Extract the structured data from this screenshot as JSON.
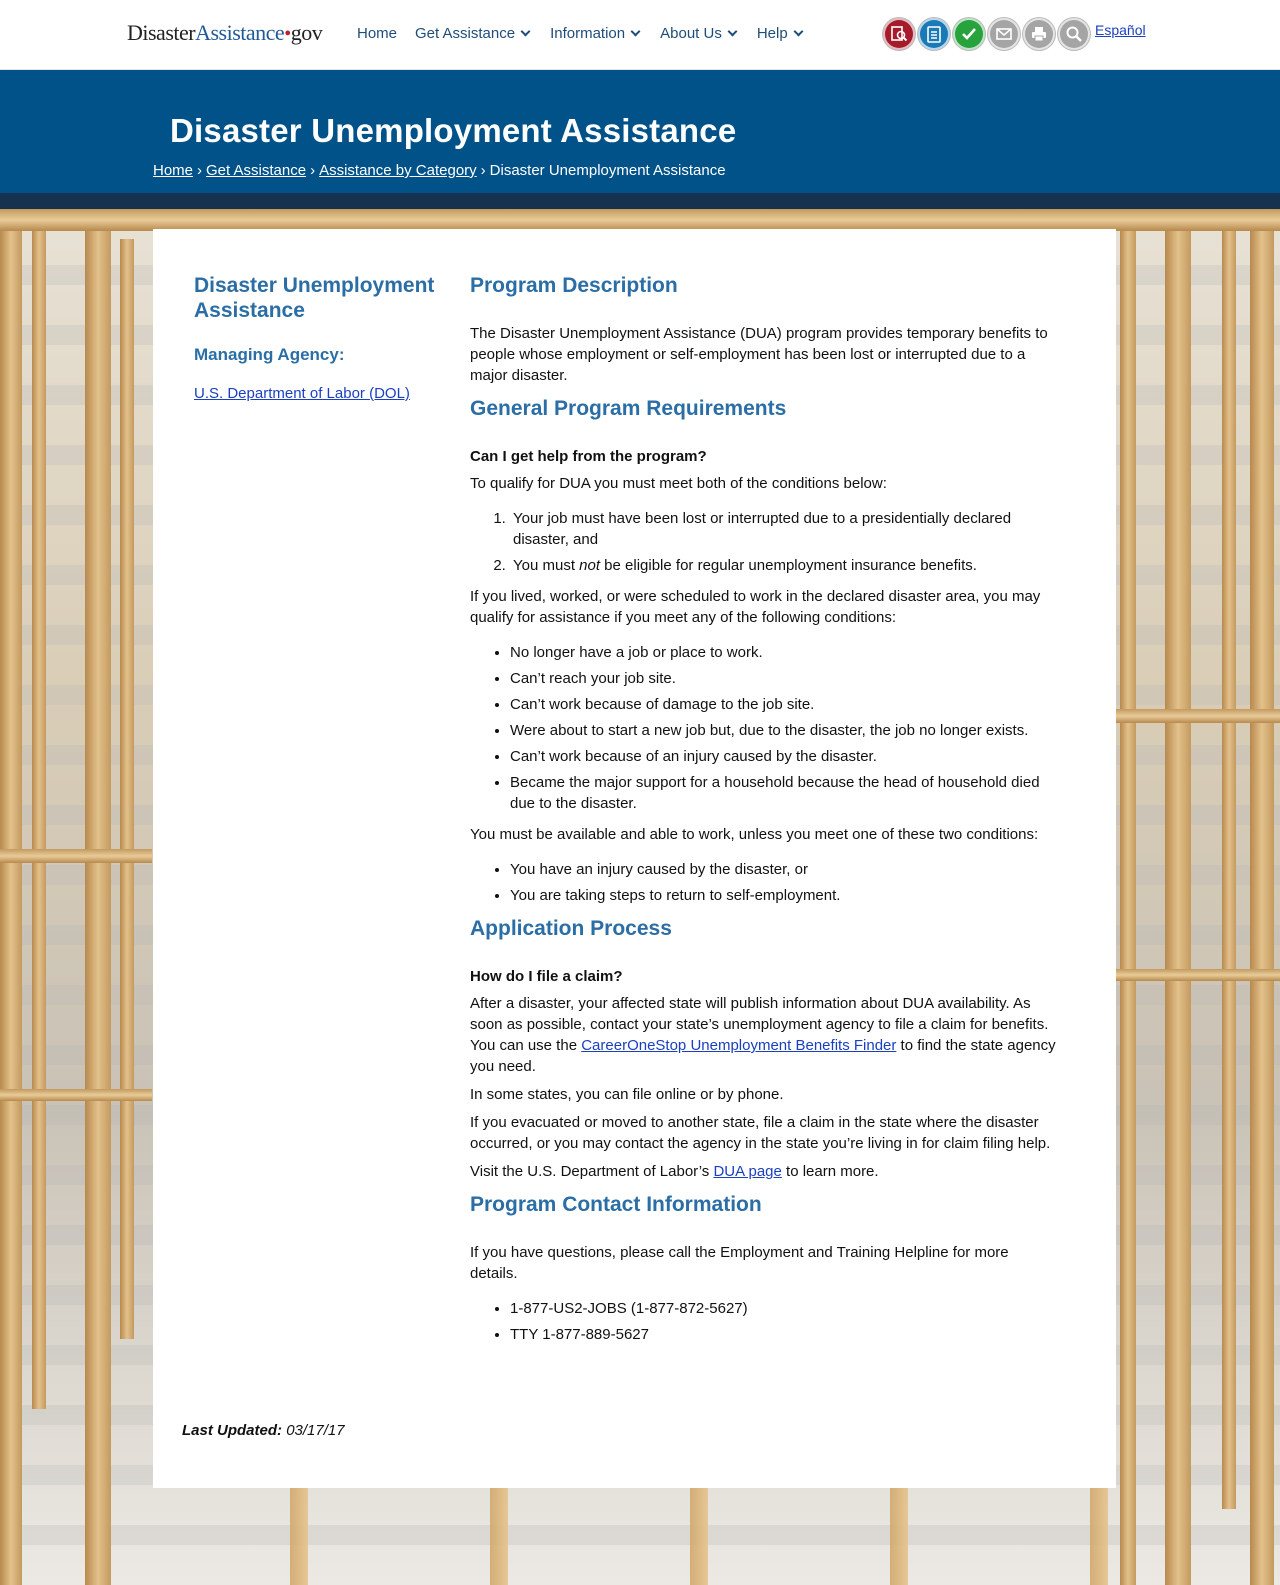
{
  "header": {
    "logo": {
      "part1": "Disaster",
      "part2": "Assistance",
      "dot": "•",
      "part3": "gov"
    },
    "nav": [
      {
        "label": "Home",
        "dropdown": false
      },
      {
        "label": "Get Assistance",
        "dropdown": true
      },
      {
        "label": "Information",
        "dropdown": true
      },
      {
        "label": "About Us",
        "dropdown": true
      },
      {
        "label": "Help",
        "dropdown": true
      }
    ],
    "tools": [
      {
        "icon": "apply-online-icon",
        "color": "#a61b2b"
      },
      {
        "icon": "check-status-icon",
        "color": "#1a7ab8"
      },
      {
        "icon": "checkmark-icon",
        "color": "#27a23d"
      },
      {
        "icon": "email-icon",
        "color": "#9a9a9a"
      },
      {
        "icon": "print-icon",
        "color": "#9a9a9a"
      },
      {
        "icon": "search-icon",
        "color": "#9a9a9a"
      }
    ],
    "language_link": "Español"
  },
  "banner": {
    "title": "Disaster Unemployment Assistance",
    "breadcrumb": [
      "Home",
      "Get Assistance",
      "Assistance by Category",
      "Disaster Unemployment Assistance"
    ],
    "separator": "›"
  },
  "sidebar": {
    "title": "Disaster Unemployment Assistance",
    "agency_label": "Managing Agency:",
    "agency_link": "U.S. Department of Labor (DOL)"
  },
  "content": {
    "description": {
      "heading": "Program Description",
      "text": "The Disaster Unemployment Assistance (DUA) program provides temporary benefits to people whose employment or self-employment has been lost or interrupted due to a major disaster."
    },
    "requirements": {
      "heading": "General Program Requirements",
      "question": "Can I get help from the program?",
      "intro": "To qualify for DUA you must meet both of the conditions below:",
      "conditions_1": "Your job must have been lost or interrupted due to a presidentially declared disaster, and",
      "conditions_2_pre": "You must ",
      "conditions_2_em": "not",
      "conditions_2_post": " be eligible for regular unemployment insurance benefits.",
      "area_text": "If you lived, worked, or were scheduled to work in the declared disaster area, you may qualify for assistance if you meet any of the following conditions:",
      "area_items": [
        "No longer have a job or place to work.",
        "Can’t reach your job site.",
        "Can’t work because of damage to the job site.",
        "Were about to start a new job but, due to the disaster, the job no longer exists.",
        "Can’t work because of an injury caused by the disaster.",
        "Became the major support for a household because the head of household died due to the disaster."
      ],
      "available_text": "You must be available and able to work, unless you meet one of these two conditions:",
      "available_items": [
        "You have an injury caused by the disaster, or",
        "You are taking steps to return to self-employment."
      ]
    },
    "application": {
      "heading": "Application Process",
      "question": "How do I file a claim?",
      "p1_pre": "After a disaster, your affected state will publish information about DUA availability. As soon as possible, contact your state’s unemployment agency to file a claim for benefits. You can use the ",
      "p1_link": "CareerOneStop Unemployment Benefits Finder",
      "p1_post": " to find the state agency you need.",
      "p2": "In some states, you can file online or by phone.",
      "p3": "If you evacuated or moved to another state, file a claim in the state where the disaster occurred, or you may contact the agency in the state you’re living in for claim filing help.",
      "p4_pre": "Visit the U.S. Department of Labor’s ",
      "p4_link": "DUA page",
      "p4_post": " to learn more."
    },
    "contact": {
      "heading": "Program Contact Information",
      "text": "If you have questions, please call the Employment and Training Helpline for more details.",
      "items": [
        "1-877-US2-JOBS (1-877-872-5627)",
        "TTY 1-877-889-5627"
      ]
    }
  },
  "footer": {
    "last_updated_label": "Last Updated:",
    "last_updated_date": "03/17/17"
  }
}
